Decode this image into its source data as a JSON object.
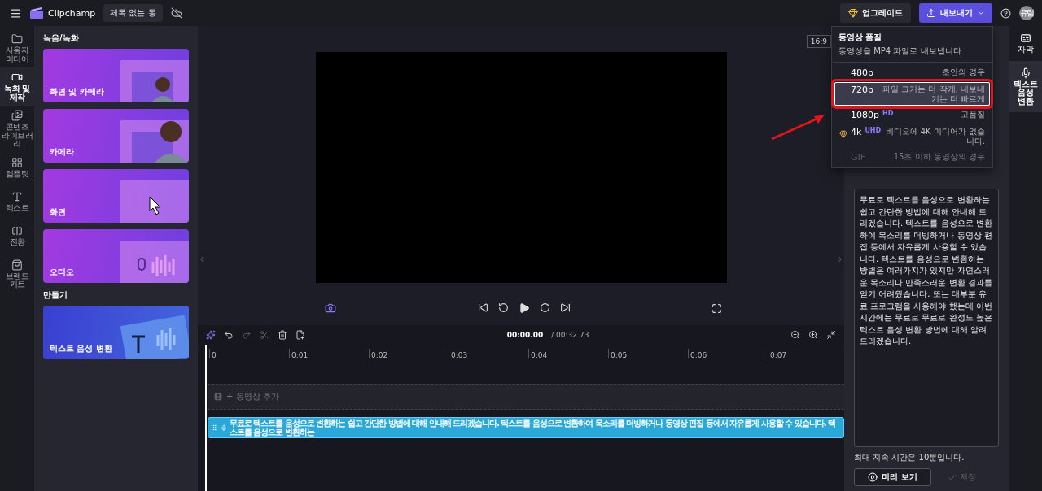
{
  "app": {
    "name": "Clipchamp",
    "project_title": "제목 없는 동",
    "upgrade": "업그레이드",
    "export": "내보내기",
    "avatar": "유림"
  },
  "nav": [
    {
      "label": "사용자 미디어",
      "selected": false
    },
    {
      "label": "녹화 및 제작",
      "selected": true
    },
    {
      "label": "콘텐츠 라이브러리",
      "selected": false
    },
    {
      "label": "템플릿",
      "selected": false
    },
    {
      "label": "텍스트",
      "selected": false
    },
    {
      "label": "전환",
      "selected": false
    },
    {
      "label": "브랜드 키트",
      "selected": false
    }
  ],
  "panel": {
    "sections": [
      {
        "title": "녹음/녹화",
        "cards": [
          {
            "label": "화면 및 카메라",
            "kind": "screen-camera"
          },
          {
            "label": "카메라",
            "kind": "camera"
          },
          {
            "label": "화면",
            "kind": "screen"
          },
          {
            "label": "오디오",
            "kind": "audio"
          }
        ]
      },
      {
        "title": "만들기",
        "cards": [
          {
            "label": "텍스트 음성 변환",
            "kind": "tts"
          }
        ]
      }
    ]
  },
  "preview": {
    "aspect": "16:9"
  },
  "timeline": {
    "current": "00:00.00",
    "total": "/ 00:32.73",
    "ticks": [
      "0",
      "0:01",
      "0:02",
      "0:03",
      "0:04",
      "0:05",
      "0:06",
      "0:07"
    ],
    "video_track": "+ 동영상 추가",
    "audio_clip": "무료로 텍스트를 음성으로 변환하는 쉽고 간단한 방법에 대해 안내해 드리겠습니다. 텍스트를 음성으로 변환하여 목소리를 더빙하거나 동영상 편집 등에서 자유롭게 사용할 수 있습니다. 텍스트를 음성으로 변환하는"
  },
  "export_menu": {
    "title": "동영상 품질",
    "subtitle": "동영상을 MP4 파일로 내보냅니다",
    "options": [
      {
        "label": "480p",
        "description": "초안의 경우",
        "selected": false,
        "disabled": false,
        "premium": false,
        "highlighted": false
      },
      {
        "label": "720p",
        "description": "파일 크기는 더 작게, 내보내기는 더 빠르게",
        "selected": true,
        "disabled": false,
        "premium": false,
        "highlighted": true
      },
      {
        "label": "1080p",
        "badge": "HD",
        "description": "고품질",
        "selected": false,
        "disabled": false,
        "premium": false,
        "highlighted": false
      },
      {
        "label": "4k",
        "badge": "UHD",
        "description": "비디오에 4K 미디어가 없습니다.",
        "selected": false,
        "disabled": false,
        "premium": true,
        "highlighted": false
      },
      {
        "label": "GIF",
        "description": "15초 이하 동영상의 경우",
        "selected": false,
        "disabled": true,
        "premium": false,
        "highlighted": false
      }
    ]
  },
  "right_panel": {
    "script": "무료로 텍스트를 음성으로 변환하는 쉽고 간단한 방법에 대해 안내해 드리겠습니다. 텍스트를 음성으로 변환하여 목소리를 더빙하거나 동영상 편집 등에서 자유롭게 사용할 수 있습니다. 텍스트를 음성으로 변환하는 방법은 여러가지가 있지만 자연스러운 목소리나 만족스러운 변환 결과를 얻기 어려웠습니다. 또는 대부분 유료 프로그램을 사용해야 했는데 이번 시간에는 무료로 무료로 완성도 높은 텍스트 음성 변환 방법에 대해 알려드리겠습니다.",
    "note": "최대 지속 시간은 10분입니다.",
    "preview_button": "미리 보기",
    "save_button": "저장",
    "save_disabled": true
  },
  "right_rail": [
    {
      "label": "자막",
      "selected": false
    },
    {
      "label": "텍스트 음성 변환",
      "selected": true
    }
  ]
}
